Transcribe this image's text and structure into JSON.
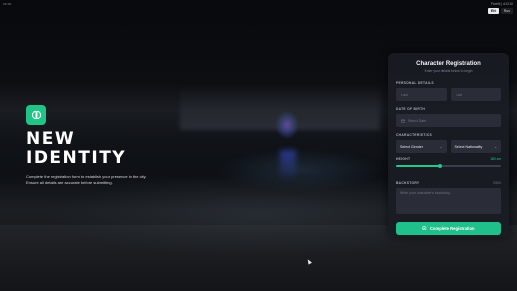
{
  "window": {
    "corner_tag": "00:00",
    "server_info": "FiveM | #1210",
    "lang_options": [
      "EN",
      "Rus"
    ]
  },
  "hero": {
    "icon": "brain-icon",
    "title": "NEW IDENTITY",
    "description": "Complete the registration form to establish your presence in the city. Ensure all details are accurate before submitting."
  },
  "form": {
    "title": "Character Registration",
    "subtitle": "Enter your details below to begin",
    "personal_label": "PERSONAL DETAILS",
    "first_name_placeholder": "Last",
    "last_name_placeholder": "Last",
    "dob_label": "DATE OF BIRTH",
    "dob_placeholder": "Select Date",
    "characteristics_label": "CHARACTERISTICS",
    "gender_select": "Select Gender",
    "nationality_select": "Select Nationality",
    "height_label": "HEIGHT",
    "height_value": "180 cm",
    "height_fraction": 0.42,
    "backstory_label": "BACKSTORY",
    "backstory_counter": "0/500",
    "backstory_placeholder": "Write your character's backstory...",
    "submit_label": "Complete Registration",
    "submit_icon": "check-circle-icon"
  },
  "colors": {
    "accent": "#20c487",
    "panel": "#1a1c24",
    "field": "#2a2d38"
  }
}
